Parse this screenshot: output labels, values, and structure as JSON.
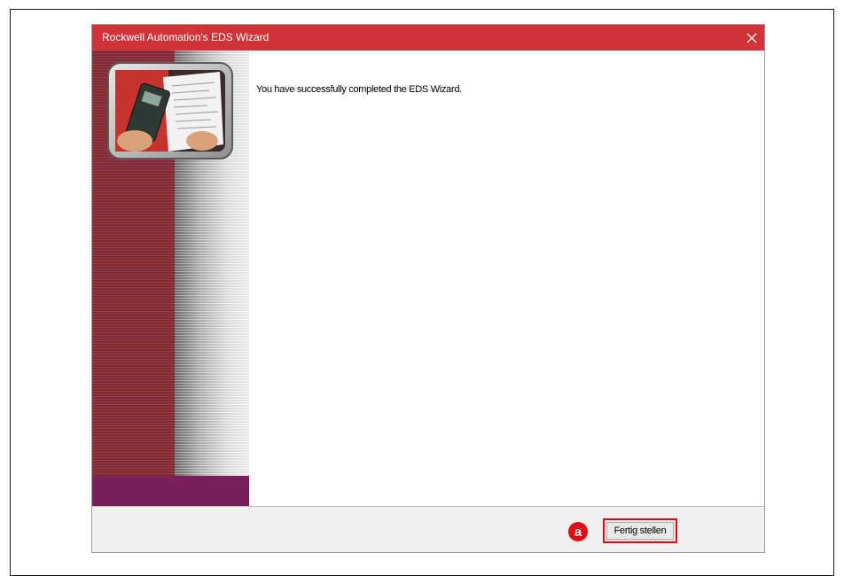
{
  "window": {
    "title": "Rockwell Automation's EDS Wizard",
    "close_icon": "close-icon",
    "titlebar_color": "#d13438"
  },
  "sidebar": {
    "image": "hands-holding-device-and-documents-image",
    "stripe_color": "#7d2d36",
    "footer_color": "#7b1f5a"
  },
  "content": {
    "message": "You have successfully completed the EDS Wizard."
  },
  "footer": {
    "finish_label": "Fertig stellen",
    "annotation_marker": "a",
    "annotation_color": "#e30613"
  }
}
